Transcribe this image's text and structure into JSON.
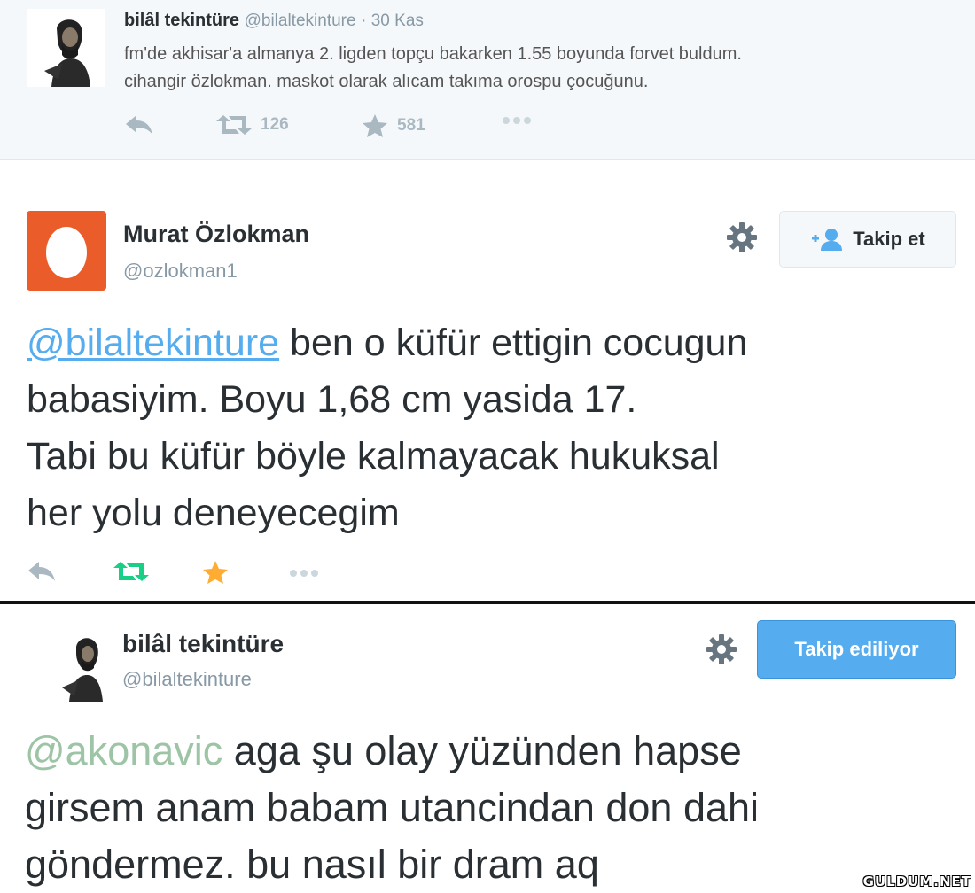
{
  "tweet1": {
    "name": "bilâl tekintüre",
    "handle": "@bilaltekinture",
    "time": "· 30 Kas",
    "text_line1": "fm'de akhisar'a almanya 2. ligden topçu bakarken 1.55 boyunda forvet buldum.",
    "text_line2": "cihangir özlokman. maskot olarak alıcam takıma orospu çocuğunu.",
    "retweets": "126",
    "favorites": "581"
  },
  "tweet2": {
    "name": "Murat Özlokman",
    "handle": "@ozlokman1",
    "follow_label": "Takip et",
    "mention": "@bilaltekinture",
    "line1_rest": " ben o küfür ettigin cocugun",
    "line2": "babasiyim. Boyu 1,68 cm yasida 17.",
    "line3": "Tabi bu küfür böyle kalmayacak hukuksal",
    "line4": "her yolu deneyecegim"
  },
  "tweet3": {
    "name": "bilâl tekintüre",
    "handle": "@bilaltekinture",
    "following_label": "Takip ediliyor",
    "mention": "@akonavic",
    "line1_rest": " aga şu olay yüzünden hapse",
    "line2": "girsem anam babam utancindan don dahi",
    "line3": "göndermez. bu nasıl bir dram aq"
  },
  "watermark": "GULDUM.NET",
  "colors": {
    "accent_blue": "#55acee",
    "retweet_green": "#19cf86",
    "favorite_orange": "#ffac33",
    "egg_orange": "#ea5d2b"
  },
  "icons": [
    "reply-icon",
    "retweet-icon",
    "star-icon",
    "more-icon",
    "gear-icon",
    "follow-user-icon"
  ]
}
